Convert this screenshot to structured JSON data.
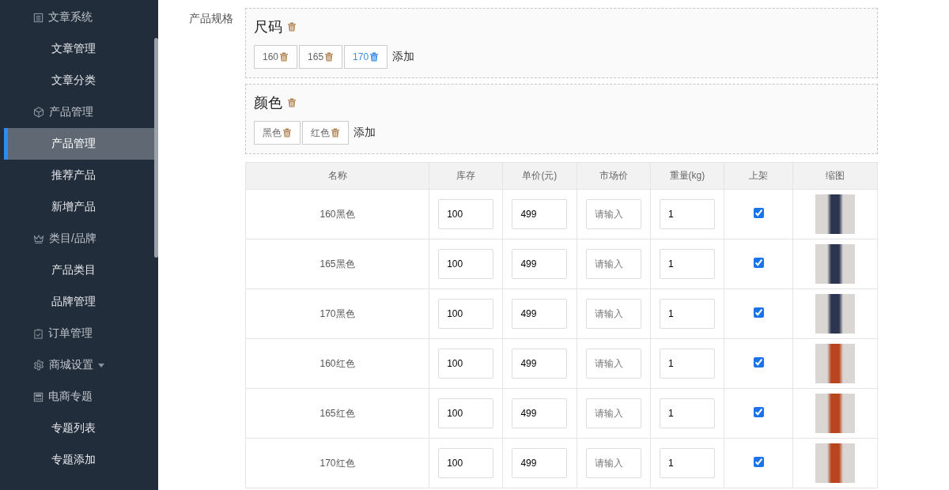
{
  "sidebar": {
    "items": [
      {
        "label": "文章系统",
        "kind": "group",
        "selected": false
      },
      {
        "label": "文章管理",
        "selected": false
      },
      {
        "label": "文章分类",
        "selected": false
      },
      {
        "label": "产品管理",
        "kind": "group",
        "selected": false
      },
      {
        "label": "产品管理",
        "selected": true
      },
      {
        "label": "推荐产品",
        "selected": false
      },
      {
        "label": "新增产品",
        "selected": false
      },
      {
        "label": "类目/品牌",
        "kind": "group",
        "selected": false
      },
      {
        "label": "产品类目",
        "selected": false
      },
      {
        "label": "品牌管理",
        "selected": false
      },
      {
        "label": "订单管理",
        "kind": "group",
        "selected": false
      },
      {
        "label": "商城设置",
        "kind": "group",
        "caret": true,
        "selected": false
      },
      {
        "label": "电商专题",
        "kind": "group",
        "selected": false
      },
      {
        "label": "专题列表",
        "selected": false
      },
      {
        "label": "专题添加",
        "selected": false
      }
    ]
  },
  "spec_label": "产品规格",
  "specs": [
    {
      "name": "尺码",
      "values": [
        {
          "text": "160",
          "hovered": false
        },
        {
          "text": "165",
          "hovered": false
        },
        {
          "text": "170",
          "hovered": true
        }
      ],
      "add": "添加"
    },
    {
      "name": "颜色",
      "values": [
        {
          "text": "黑色",
          "hovered": false
        },
        {
          "text": "红色",
          "hovered": false
        }
      ],
      "add": "添加"
    }
  ],
  "table": {
    "columns": [
      "名称",
      "库存",
      "单价(元)",
      "市场价",
      "重量(kg)",
      "上架",
      "缩图"
    ],
    "rows": [
      {
        "name": "160黑色",
        "stock": "100",
        "price": "499",
        "market_placeholder": "请输入",
        "weight": "1",
        "on_sale": true
      },
      {
        "name": "165黑色",
        "stock": "100",
        "price": "499",
        "market_placeholder": "请输入",
        "weight": "1",
        "on_sale": true
      },
      {
        "name": "170黑色",
        "stock": "100",
        "price": "499",
        "market_placeholder": "请输入",
        "weight": "1",
        "on_sale": true
      },
      {
        "name": "160红色",
        "stock": "100",
        "price": "499",
        "market_placeholder": "请输入",
        "weight": "1",
        "on_sale": true
      },
      {
        "name": "165红色",
        "stock": "100",
        "price": "499",
        "market_placeholder": "请输入",
        "weight": "1",
        "on_sale": true
      },
      {
        "name": "170红色",
        "stock": "100",
        "price": "499",
        "market_placeholder": "请输入",
        "weight": "1",
        "on_sale": true
      }
    ]
  }
}
